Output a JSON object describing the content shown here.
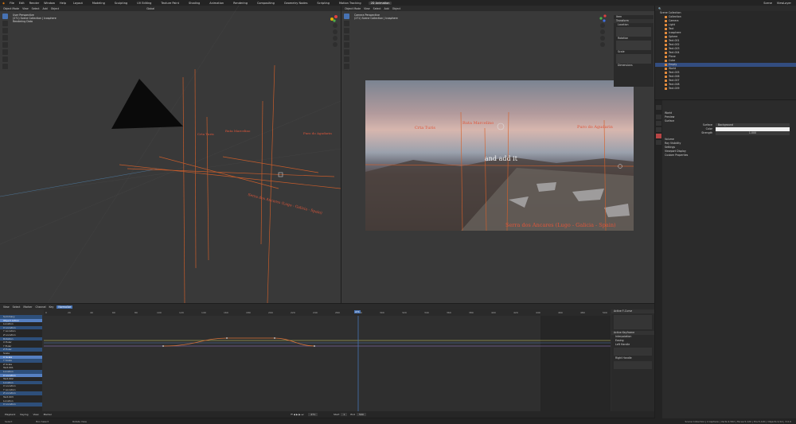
{
  "menu": {
    "items": [
      "File",
      "Edit",
      "Render",
      "Window",
      "Help"
    ]
  },
  "workspaces": {
    "tabs": [
      "Layout",
      "Modeling",
      "Sculpting",
      "UV Editing",
      "Texture Paint",
      "Shading",
      "Animation",
      "Rendering",
      "Compositing",
      "Geometry Nodes",
      "Scripting",
      "Motion Tracking",
      "2D Animation"
    ],
    "active_index": 12
  },
  "topbar_right": {
    "scene": "Scene",
    "view_layer": "ViewLayer"
  },
  "left_viewport": {
    "menus": [
      "Object Mode",
      "View",
      "Select",
      "Add",
      "Object"
    ],
    "transform": "Global",
    "info": [
      "User Perspective",
      "(271) Scene Collection | Icosphere",
      "Rendering Data"
    ],
    "labels": [
      "Crta Turis",
      "Ruta Marcelino",
      "Puro do Agudarin",
      "Serra dos Ancares (Lugo - Galicia - Spain)"
    ]
  },
  "right_viewport": {
    "menus": [
      "Object Mode",
      "View",
      "Select",
      "Add",
      "Object"
    ],
    "info": [
      "Camera Perspective",
      "(271) Scene Collection | Icosphere"
    ],
    "labels": [
      "Crta Turis",
      "Ruta Marcelino",
      "Puro do Agudarin",
      "Serra dos Ancares (Lugo - Galicia - Spain)"
    ],
    "caption": "and add it",
    "sidepanel": [
      "Item",
      "Transform",
      "Location",
      "Rotation",
      "Scale",
      "Dimensions"
    ]
  },
  "outliner": {
    "title": "Scene Collection",
    "rows": [
      "Collection",
      "Camera",
      "Light",
      "Text",
      "Icosphere",
      "Sphere",
      "Text.001",
      "Text.002",
      "Text.003",
      "Text.004",
      "Plane",
      "Cube",
      "Empty",
      "World",
      "Text.005",
      "Text.006",
      "Text.007",
      "Text.008",
      "Text.009"
    ],
    "selected_index": 12
  },
  "properties": {
    "sections": [
      "Preview",
      "Surface",
      "Volume",
      "Ray Visibility",
      "Settings",
      "Viewport Display",
      "Custom Properties"
    ],
    "world_name": "World",
    "surface_label": "Surface",
    "surface_value": "Background",
    "color_label": "Color",
    "strength_label": "Strength",
    "strength_value": "1.000"
  },
  "graph_editor": {
    "menus": [
      "View",
      "Select",
      "Marker",
      "Channel",
      "Key"
    ],
    "mode": "Normalize",
    "channels": [
      "Summary",
      "Object Action",
      "Location",
      "X Location",
      "Y Location",
      "Z Location",
      "Rotation",
      "X Euler",
      "Y Euler",
      "Z Euler",
      "Scale",
      "X Scale",
      "Y Scale",
      "Z Scale",
      "Text.001",
      "Location",
      "X Location",
      "Text.002",
      "Location",
      "X Location",
      "Y Location",
      "Z Location",
      "Text.003",
      "Location",
      "X Location"
    ],
    "frames": [
      "0",
      "20",
      "40",
      "60",
      "80",
      "100",
      "120",
      "140",
      "160",
      "180",
      "200",
      "220",
      "240",
      "260",
      "280",
      "300",
      "320",
      "340",
      "360",
      "380",
      "400",
      "420",
      "440",
      "460",
      "480",
      "500"
    ],
    "current_frame": "271",
    "fcurve_panel": [
      "Active F-Curve",
      "Active Keyframe",
      "Interpolation",
      "Easing",
      "Left Handle",
      "Right Handle"
    ]
  },
  "timeline": {
    "items": [
      "Playback",
      "Keying",
      "View",
      "Marker"
    ],
    "frame_value": "271",
    "start_label": "Start",
    "start_value": "1",
    "end_label": "End",
    "end_value": "500"
  },
  "statusbar": {
    "items": [
      "Select",
      "Box Select",
      "Rotate View"
    ],
    "right_text": "Scene Collection | Icosphere | Verts:2,562 | Faces:5,120 | Tris:5,120 | Objects:1/14 | 3.0.0"
  },
  "colors": {
    "accent": "#4772b3",
    "label": "#e0563a",
    "orange_line": "#d6602a"
  }
}
